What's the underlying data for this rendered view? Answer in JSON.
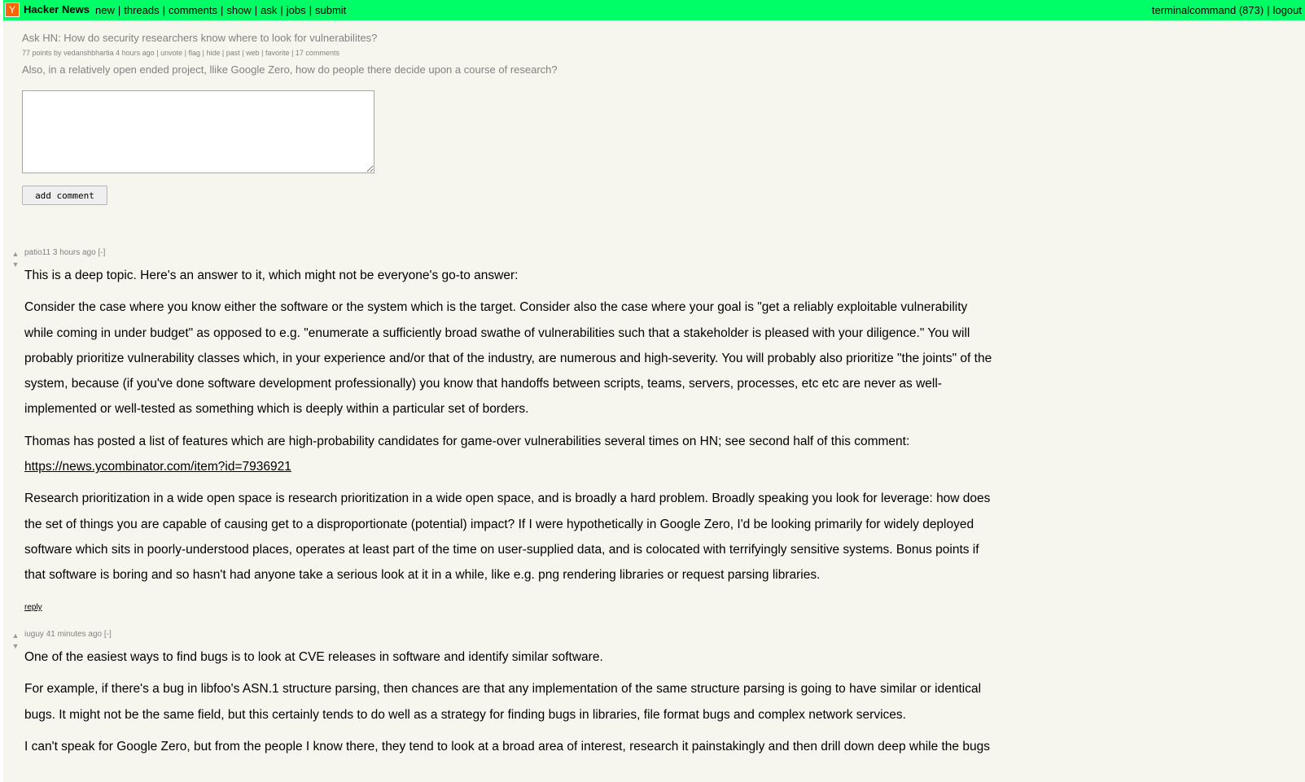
{
  "header": {
    "logo": "Y",
    "site_name": "Hacker News",
    "nav": [
      "new",
      "threads",
      "comments",
      "show",
      "ask",
      "jobs",
      "submit"
    ],
    "user": "terminalcommand",
    "karma": "(873)",
    "logout": "logout",
    "bar_color": "#00ff66"
  },
  "story": {
    "title": "Ask HN: How do security researchers know where to look for vulnerabilites?",
    "points": "77 points",
    "by": "by",
    "author": "vedanshbhartia",
    "age": "4 hours ago",
    "links": [
      "unvote",
      "flag",
      "hide",
      "past",
      "web",
      "favorite",
      "17 comments"
    ],
    "text": "Also, in a relatively open ended project, llike Google Zero, how do people there decide upon a course of research?"
  },
  "form": {
    "comment_value": "",
    "submit_label": "add comment"
  },
  "comments": [
    {
      "user": "patio11",
      "age": "3 hours ago",
      "toggle": "[-]",
      "paragraphs": [
        "This is a deep topic. Here's an answer to it, which might not be everyone's go-to answer:",
        "Consider the case where you know either the software or the system which is the target. Consider also the case where your goal is \"get a reliably exploitable vulnerability while coming in under budget\" as opposed to e.g. \"enumerate a sufficiently broad swathe of vulnerabilities such that a stakeholder is pleased with your diligence.\" You will probably prioritize vulnerability classes which, in your experience and/or that of the industry, are numerous and high-severity. You will probably also prioritize \"the joints\" of the system, because (if you've done software development professionally) you know that handoffs between scripts, teams, servers, processes, etc etc are never as well-implemented or well-tested as something which is deeply within a particular set of borders.",
        "Thomas has posted a list of features which are high-probability candidates for game-over vulnerabilities several times on HN; see second half of this comment:",
        "Research prioritization in a wide open space is research prioritization in a wide open space, and is broadly a hard problem. Broadly speaking you look for leverage: how does the set of things you are capable of causing get to a disproportionate (potential) impact? If I were hypothetically in Google Zero, I'd be looking primarily for widely deployed software which sits in poorly-understood places, operates at least part of the time on user-supplied data, and is colocated with terrifyingly sensitive systems. Bonus points if that software is boring and so hasn't had anyone take a serious look at it in a while, like e.g. png rendering libraries or request parsing libraries."
      ],
      "link": "https://news.ycombinator.com/item?id=7936921",
      "reply": "reply"
    },
    {
      "user": "iuguy",
      "age": "41 minutes ago",
      "toggle": "[-]",
      "paragraphs": [
        "One of the easiest ways to find bugs is to look at CVE releases in software and identify similar software.",
        "For example, if there's a bug in libfoo's ASN.1 structure parsing, then chances are that any implementation of the same structure parsing is going to have similar or identical bugs. It might not be the same field, but this certainly tends to do well as a strategy for finding bugs in libraries, file format bugs and complex network services.",
        "I can't speak for Google Zero, but from the people I know there, they tend to look at a broad area of interest, research it painstakingly and then drill down deep while the bugs"
      ]
    }
  ],
  "glyphs": {
    "up": "▲",
    "down": "▼"
  }
}
